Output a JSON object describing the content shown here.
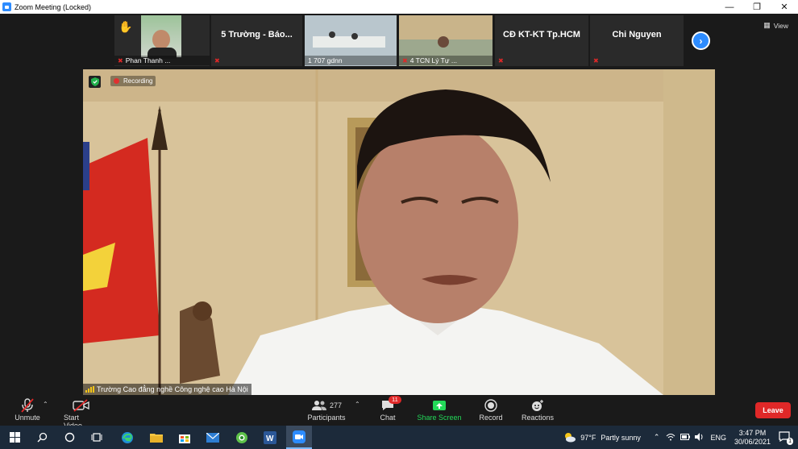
{
  "window": {
    "title": "Zoom Meeting (Locked)"
  },
  "strip": {
    "thumbs": [
      {
        "name": "Phan Thanh ..."
      },
      {
        "name": "5 Trường - Báo..."
      },
      {
        "name": "1 707 gdnn"
      },
      {
        "name": "4 TCN Lý Tự ..."
      },
      {
        "name": "CĐ KT-KT Tp.HCM"
      },
      {
        "name": "Chi Nguyen"
      }
    ],
    "view_label": "View"
  },
  "main": {
    "recording_label": "Recording",
    "speaker_name": "Trường Cao đẳng nghề Công nghệ cao Hà Nội"
  },
  "toolbar": {
    "unmute": "Unmute",
    "start_video": "Start Video",
    "participants": "Participants",
    "participants_count": "277",
    "chat": "Chat",
    "chat_badge": "11",
    "share_screen": "Share Screen",
    "record": "Record",
    "reactions": "Reactions",
    "leave": "Leave"
  },
  "taskbar": {
    "temperature": "97°F",
    "weather": "Partly sunny",
    "lang": "ENG",
    "time": "3:47 PM",
    "date": "30/06/2021",
    "notif_count": "1"
  },
  "colors": {
    "accent": "#2d8cff",
    "danger": "#e02828",
    "share": "#23d959"
  }
}
